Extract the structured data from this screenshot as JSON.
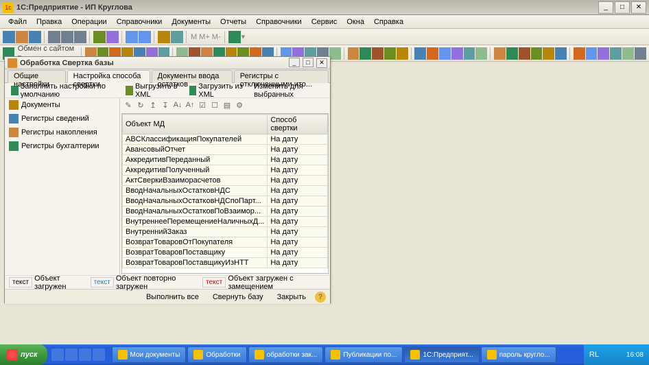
{
  "app": {
    "title": "1С:Предприятие - ИП Круглова"
  },
  "win_buttons": {
    "min": "_",
    "max": "□",
    "close": "✕"
  },
  "menu": [
    "Файл",
    "Правка",
    "Операции",
    "Справочники",
    "Документы",
    "Отчеты",
    "Справочники",
    "Сервис",
    "Окна",
    "Справка"
  ],
  "toolbar1_text": "Обмен с сайтом ▾",
  "toolbar_m": {
    "m1": "M",
    "m2": "M+",
    "m3": "M-"
  },
  "child": {
    "title": "Обработка  Свертка базы",
    "tabs": [
      "Общие настройки",
      "Настройка способа свертки",
      "Документы ввода остатков",
      "Регистры с отключенными ито..."
    ],
    "active_tab": 1,
    "actions": {
      "fill_defaults": "Заполнить настройки по умолчанию",
      "export_xml": "Выгрузить в XML",
      "import_xml": "Загрузить из XML",
      "change_selected": "Изменить для выбранных"
    },
    "sidebar": [
      "Документы",
      "Регистры сведений",
      "Регистры накопления",
      "Регистры бухгалтерии"
    ],
    "columns": {
      "c1": "Объект МД",
      "c2": "Способ свертки"
    },
    "rows": [
      {
        "obj": "ABCКлассификацияПокупателей",
        "mode": "На дату"
      },
      {
        "obj": "АвансовыйОтчет",
        "mode": "На дату"
      },
      {
        "obj": "АккредитивПереданный",
        "mode": "На дату"
      },
      {
        "obj": "АккредитивПолученный",
        "mode": "На дату"
      },
      {
        "obj": "АктСверкиВзаиморасчетов",
        "mode": "На дату"
      },
      {
        "obj": "ВводНачальныхОстатковНДС",
        "mode": "На дату"
      },
      {
        "obj": "ВводНачальныхОстатковНДСпоПарт...",
        "mode": "На дату"
      },
      {
        "obj": "ВводНачальныхОстатковПоВзаимор...",
        "mode": "На дату"
      },
      {
        "obj": "ВнутреннееПеремещениеНаличныхД...",
        "mode": "На дату"
      },
      {
        "obj": "ВнутреннийЗаказ",
        "mode": "На дату"
      },
      {
        "obj": "ВозвратТоваровОтПокупателя",
        "mode": "На дату"
      },
      {
        "obj": "ВозвратТоваровПоставщику",
        "mode": "На дату"
      },
      {
        "obj": "ВозвратТоваровПоставщикуИзНТТ",
        "mode": "На дату"
      }
    ],
    "legend": {
      "label": "текст",
      "loaded": "Объект загружен",
      "reloaded": "Объект повторно загружен",
      "replaced": "Объект загружен с замещением"
    },
    "footer": {
      "run_all": "Выполнить все",
      "collapse": "Свернуть базу",
      "close": "Закрыть"
    }
  },
  "taskbar": {
    "start": "пуск",
    "tasks": [
      "Мои документы",
      "Обработки",
      "обработки зак...",
      "Публикации по...",
      "1С:Предприят...",
      "пароль кругло..."
    ],
    "active_task_index": 4,
    "lang": "RL",
    "clock": "16:08"
  }
}
